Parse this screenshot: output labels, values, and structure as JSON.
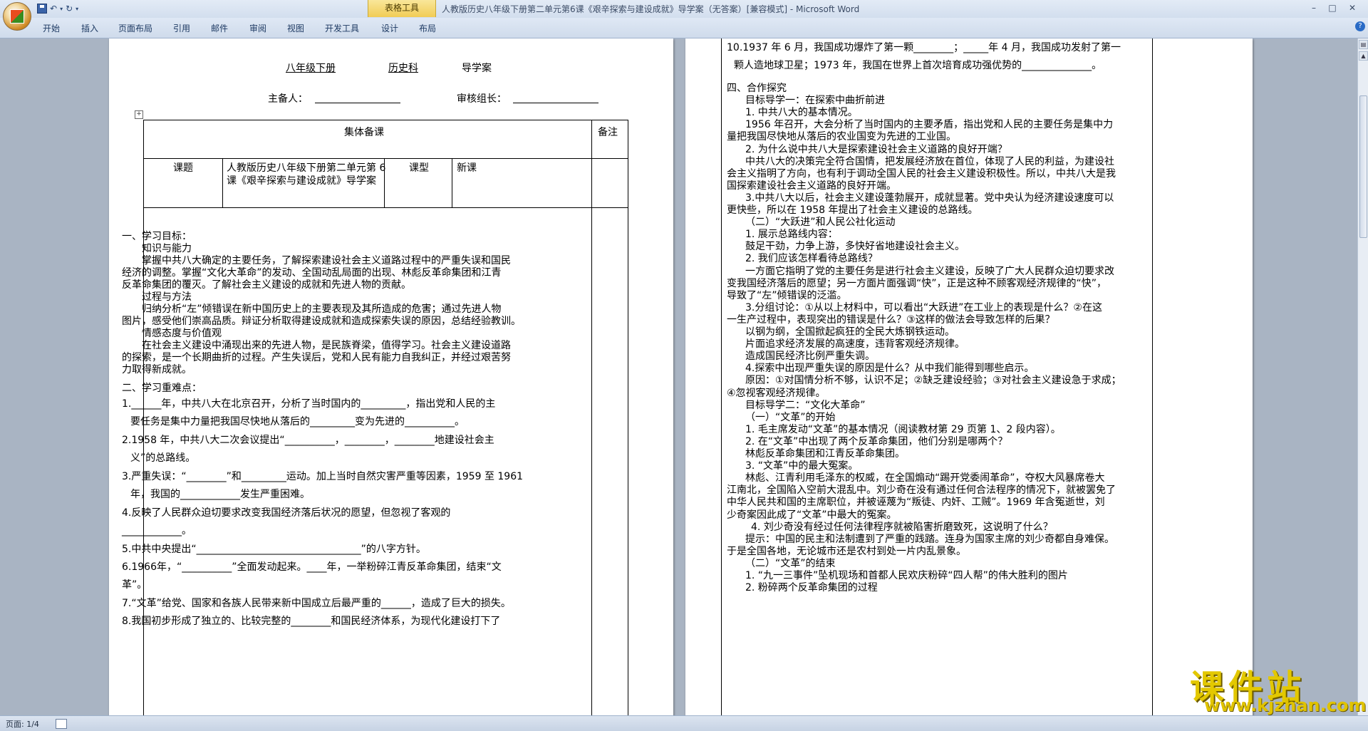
{
  "titlebar": {
    "table_tools": "表格工具",
    "title": "人教版历史八年级下册第二单元第6课《艰辛探索与建设成就》导学案（无答案）[兼容模式] - Microsoft Word",
    "minimize": "–",
    "restore": "□",
    "close": "✕"
  },
  "ribbon": {
    "tabs": [
      "开始",
      "插入",
      "页面布局",
      "引用",
      "邮件",
      "审阅",
      "视图",
      "开发工具",
      "设计",
      "布局"
    ]
  },
  "page1": {
    "header_line": [
      "八年级下册",
      "历史科",
      "导学案"
    ],
    "preparer_label": "主备人：",
    "reviewer_label": "审核组长：",
    "table": {
      "collective": "集体备课",
      "remark": "备注",
      "topic_label": "课题",
      "topic_value_1": "人教版历史八年级下册第二单元第 6",
      "topic_value_2": "课《艰辛探索与建设成就》导学案",
      "type_label": "课型",
      "type_value": "新课"
    },
    "body": [
      "一、学习目标：",
      "知识与能力",
      "掌握中共八大确定的主要任务，了解探索建设社会主义道路过程中的严重失误和国民",
      "经济的调整。掌握“文化大革命”的发动、全国动乱局面的出现、林彪反革命集团和江青",
      "反革命集团的覆灭。了解社会主义建设的成就和先进人物的贡献。",
      "过程与方法",
      "归纳分析“左”倾错误在新中国历史上的主要表现及其所造成的危害；通过先进人物",
      "图片，感受他们崇高品质。辩证分析取得建设成就和造成探索失误的原因，总结经验教训。",
      "情感态度与价值观",
      "在社会主义建设中涌现出来的先进人物，是民族脊梁，值得学习。社会主义建设道路",
      "的探索，是一个长期曲折的过程。产生失误后，党和人民有能力自我纠正，并经过艰苦努",
      "力取得新成就。",
      "二、学习重难点：",
      "1.______年，中共八大在北京召开，分析了当时国内的_________，指出党和人民的主",
      "要任务是集中力量把我国尽快地从落后的_________变为先进的__________。",
      "2.1958 年，中共八大二次会议提出“__________，________，________地建设社会主",
      "义”的总路线。",
      "3.严重失误：“________”和_________运动。加上当时自然灾害严重等因素，1959 至 1961",
      "年，我国的____________发生严重困难。",
      "4.反映了人民群众迫切要求改变我国经济落后状况的愿望，但忽视了客观的",
      "____________。",
      "5.中共中央提出“_________________________________”的八字方针。",
      "6.1966年，“__________”全面发动起来。____年，一举粉碎江青反革命集团，结束“文",
      "革”。",
      "7.“文革”给党、国家和各族人民带来新中国成立后最严重的______，造成了巨大的损失。",
      "8.我国初步形成了独立的、比较完整的________和国民经济体系，为现代化建设打下了"
    ]
  },
  "page2": {
    "lines": [
      "10.1937 年 6 月，我国成功爆炸了第一颗________；_____年 4 月，我国成功发射了第一",
      "颗人造地球卫星；1973 年，我国在世界上首次培育成功强优势的______________。",
      "四、合作探究",
      "目标导学一：在探索中曲折前进",
      "1. 中共八大的基本情况。",
      "1956 年召开，大会分析了当时国内的主要矛盾，指出党和人民的主要任务是集中力",
      "量把我国尽快地从落后的农业国变为先进的工业国。",
      "2. 为什么说中共八大是探索建设社会主义道路的良好开端？",
      "中共八大的决策完全符合国情，把发展经济放在首位，体现了人民的利益，为建设社",
      "会主义指明了方向，也有利于调动全国人民的社会主义建设积极性。所以，中共八大是我",
      "国探索建设社会主义道路的良好开端。",
      "3.中共八大以后，社会主义建设蓬勃展开，成就显著。党中央认为经济建设速度可以",
      "更快些，所以在 1958 年提出了社会主义建设的总路线。",
      "（二）“大跃进”和人民公社化运动",
      "1. 展示总路线内容：",
      "鼓足干劲，力争上游，多快好省地建设社会主义。",
      "2. 我们应该怎样看待总路线？",
      "一方面它指明了党的主要任务是进行社会主义建设，反映了广大人民群众迫切要求改",
      "变我国经济落后的愿望；另一方面片面强调“快”，正是这种不顾客观经济规律的“快”，",
      "导致了“左”倾错误的泛滥。",
      "3.分组讨论：①从以上材料中，可以看出“大跃进”在工业上的表现是什么？②在这",
      "一生产过程中，表现突出的错误是什么？③这样的做法会导致怎样的后果？",
      "以钢为纲，全国掀起疯狂的全民大炼钢铁运动。",
      "片面追求经济发展的高速度，违背客观经济规律。",
      "造成国民经济比例严重失调。",
      "4.探索中出现严重失误的原因是什么？从中我们能得到哪些启示。",
      "原因：①对国情分析不够，认识不足；②缺乏建设经验；③对社会主义建设急于求成；",
      "④忽视客观经济规律。",
      "目标导学二：“文化大革命”",
      "（一）“文革”的开始",
      "1. 毛主席发动“文革”的基本情况（阅读教材第 29 页第 1、2 段内容）。",
      "2. 在“文革”中出现了两个反革命集团，他们分别是哪两个？",
      "林彪反革命集团和江青反革命集团。",
      "3. “文革”中的最大冤案。",
      "林彪、江青利用毛泽东的权威，在全国煽动“踢开党委闹革命”，夺权大风暴席卷大",
      "江南北，全国陷入空前大混乱中。刘少奇在没有通过任何合法程序的情况下，就被罢免了",
      "中华人民共和国的主席职位，并被诬蔑为“叛徒、内奸、工贼”。1969 年含冤逝世，刘",
      "少奇案因此成了“文革”中最大的冤案。",
      "4. 刘少奇没有经过任何法律程序就被陷害折磨致死，这说明了什么？",
      "提示：中国的民主和法制遭到了严重的践踏。连身为国家主席的刘少奇都自身难保。",
      "于是全国各地，无论城市还是农村到处一片内乱景象。",
      "（二）“文革”的结束",
      "1. “九一三事件”坠机现场和首都人民欢庆粉碎“四人帮”的伟大胜利的图片",
      "2. 粉碎两个反革命集团的过程"
    ]
  },
  "statusbar": {
    "page_info": "页面: 1/4"
  },
  "watermark": {
    "name": "课件站",
    "url": "www.kjzhan.com"
  }
}
